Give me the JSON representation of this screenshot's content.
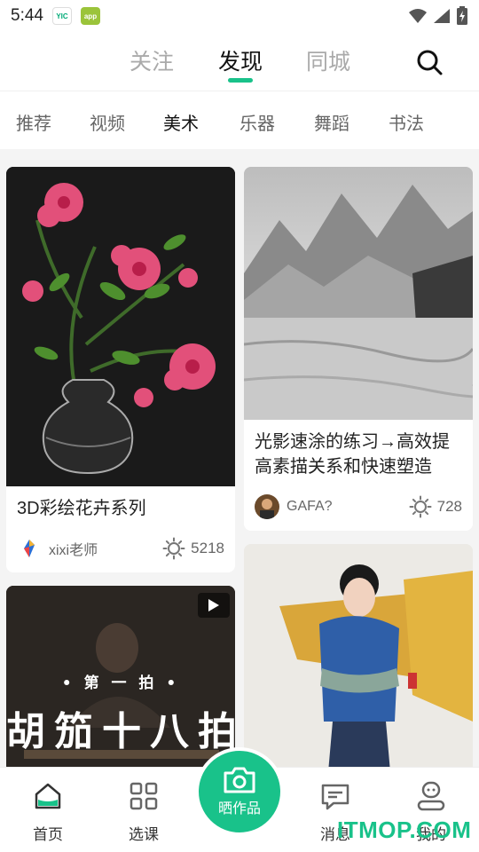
{
  "status_bar": {
    "time": "5:44",
    "app_icon_1": "YIC",
    "app_icon_2": "app"
  },
  "top_tabs": [
    {
      "label": "关注"
    },
    {
      "label": "发现"
    },
    {
      "label": "同城"
    }
  ],
  "categories": [
    {
      "label": "推荐"
    },
    {
      "label": "视频"
    },
    {
      "label": "美术"
    },
    {
      "label": "乐器"
    },
    {
      "label": "舞蹈"
    },
    {
      "label": "书法"
    }
  ],
  "cards": {
    "flowers": {
      "title": "3D彩绘花卉系列",
      "author": "xixi老师",
      "likes": "5218"
    },
    "sketch": {
      "title": "光影速涂的练习→高效提高素描关系和快速塑造",
      "author": "GAFA?",
      "likes": "728"
    },
    "video": {
      "overlay_small": "• 第 一 拍 •",
      "overlay_big": "胡笳十八拍"
    },
    "painting": {}
  },
  "bottom_nav": {
    "home": "首页",
    "courses": "选课",
    "post": "晒作品",
    "messages": "消息",
    "mine": "我的"
  },
  "watermark": "ITMOP.COM",
  "colors": {
    "accent": "#19c28a"
  }
}
